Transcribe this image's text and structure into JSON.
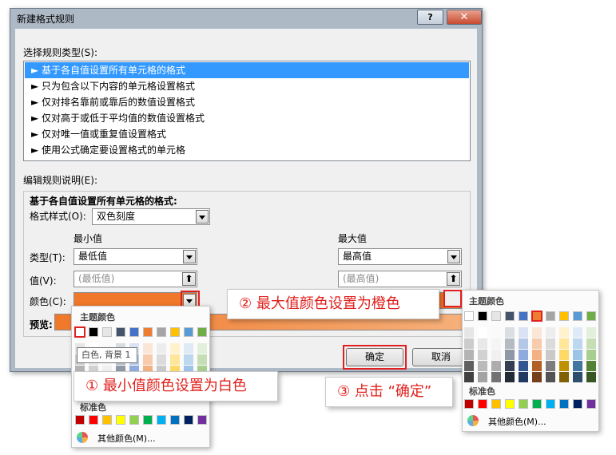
{
  "dialog": {
    "title": "新建格式规则",
    "help_glyph": "?",
    "close_glyph": "✕",
    "select_rule_type_label": "选择规则类型(S):",
    "rule_types": [
      "► 基于各自值设置所有单元格的格式",
      "► 只为包含以下内容的单元格设置格式",
      "► 仅对排名靠前或靠后的数值设置格式",
      "► 仅对高于或低于平均值的数值设置格式",
      "► 仅对唯一值或重复值设置格式",
      "► 使用公式确定要设置格式的单元格"
    ],
    "edit_rule_label": "编辑规则说明(E):",
    "group_title": "基于各自值设置所有单元格的格式:",
    "format_style_label": "格式样式(O):",
    "format_style_value": "双色刻度",
    "min_header": "最小值",
    "max_header": "最大值",
    "type_label": "类型(T):",
    "value_label": "值(V):",
    "color_label": "颜色(C):",
    "min_type": "最低值",
    "max_type": "最高值",
    "min_value_placeholder": "(最低值)",
    "max_value_placeholder": "(最高值)",
    "preview_label": "预览:",
    "ok_button": "确定",
    "cancel_button": "取消",
    "up_glyph": "⬆"
  },
  "palette_left": {
    "theme_header": "主题颜色",
    "tooltip": "白色, 背景 1",
    "standard_header": "标准色",
    "more_colors": "其他颜色(M)..."
  },
  "palette_right": {
    "theme_header": "主题颜色",
    "standard_header": "标准色",
    "more_colors": "其他颜色(M)..."
  },
  "callouts": {
    "step1": "① 最小值颜色设置为白色",
    "step2": "② 最大值颜色设置为橙色",
    "step3": "③ 点击 “确定”"
  },
  "colors": {
    "min_color": "#f0782a",
    "max_color": "#f0782a",
    "selection": "#3399ff",
    "annotation": "#e0201c",
    "theme_row": [
      "#ffffff",
      "#000000",
      "#e7e6e6",
      "#44546a",
      "#4472c4",
      "#ed7d31",
      "#a5a5a5",
      "#ffc000",
      "#5b9bd5",
      "#70ad47"
    ],
    "standard_row": [
      "#c00000",
      "#ff0000",
      "#ffc000",
      "#ffff00",
      "#92d050",
      "#00b050",
      "#00b0f0",
      "#0070c0",
      "#002060",
      "#7030a0"
    ]
  }
}
